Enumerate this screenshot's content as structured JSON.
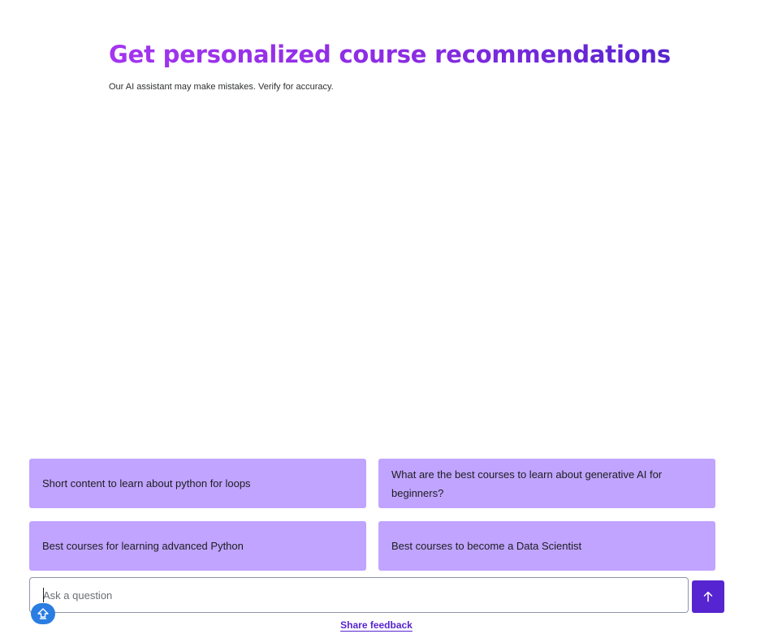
{
  "hero": {
    "title": "Get personalized course recommendations",
    "subtitle": "Our AI assistant may make mistakes. Verify for accuracy."
  },
  "suggestions": [
    {
      "label": "Short content to learn about python for loops"
    },
    {
      "label": "What are the best courses to learn about generative AI for beginners?"
    },
    {
      "label": "Best courses for learning advanced Python"
    },
    {
      "label": "Best courses to become a Data Scientist"
    }
  ],
  "input": {
    "placeholder": "Ask a question",
    "value": ""
  },
  "send_button": {
    "icon": "arrow-up-icon"
  },
  "help_badge": {
    "icon": "help-widget-icon"
  },
  "footer": {
    "feedback_label": "Share feedback"
  },
  "colors": {
    "accent": "#5624d0",
    "gradient_start": "#a435f0",
    "chip_background": "#c0a4ff",
    "badge_blue": "#2a7de1"
  }
}
